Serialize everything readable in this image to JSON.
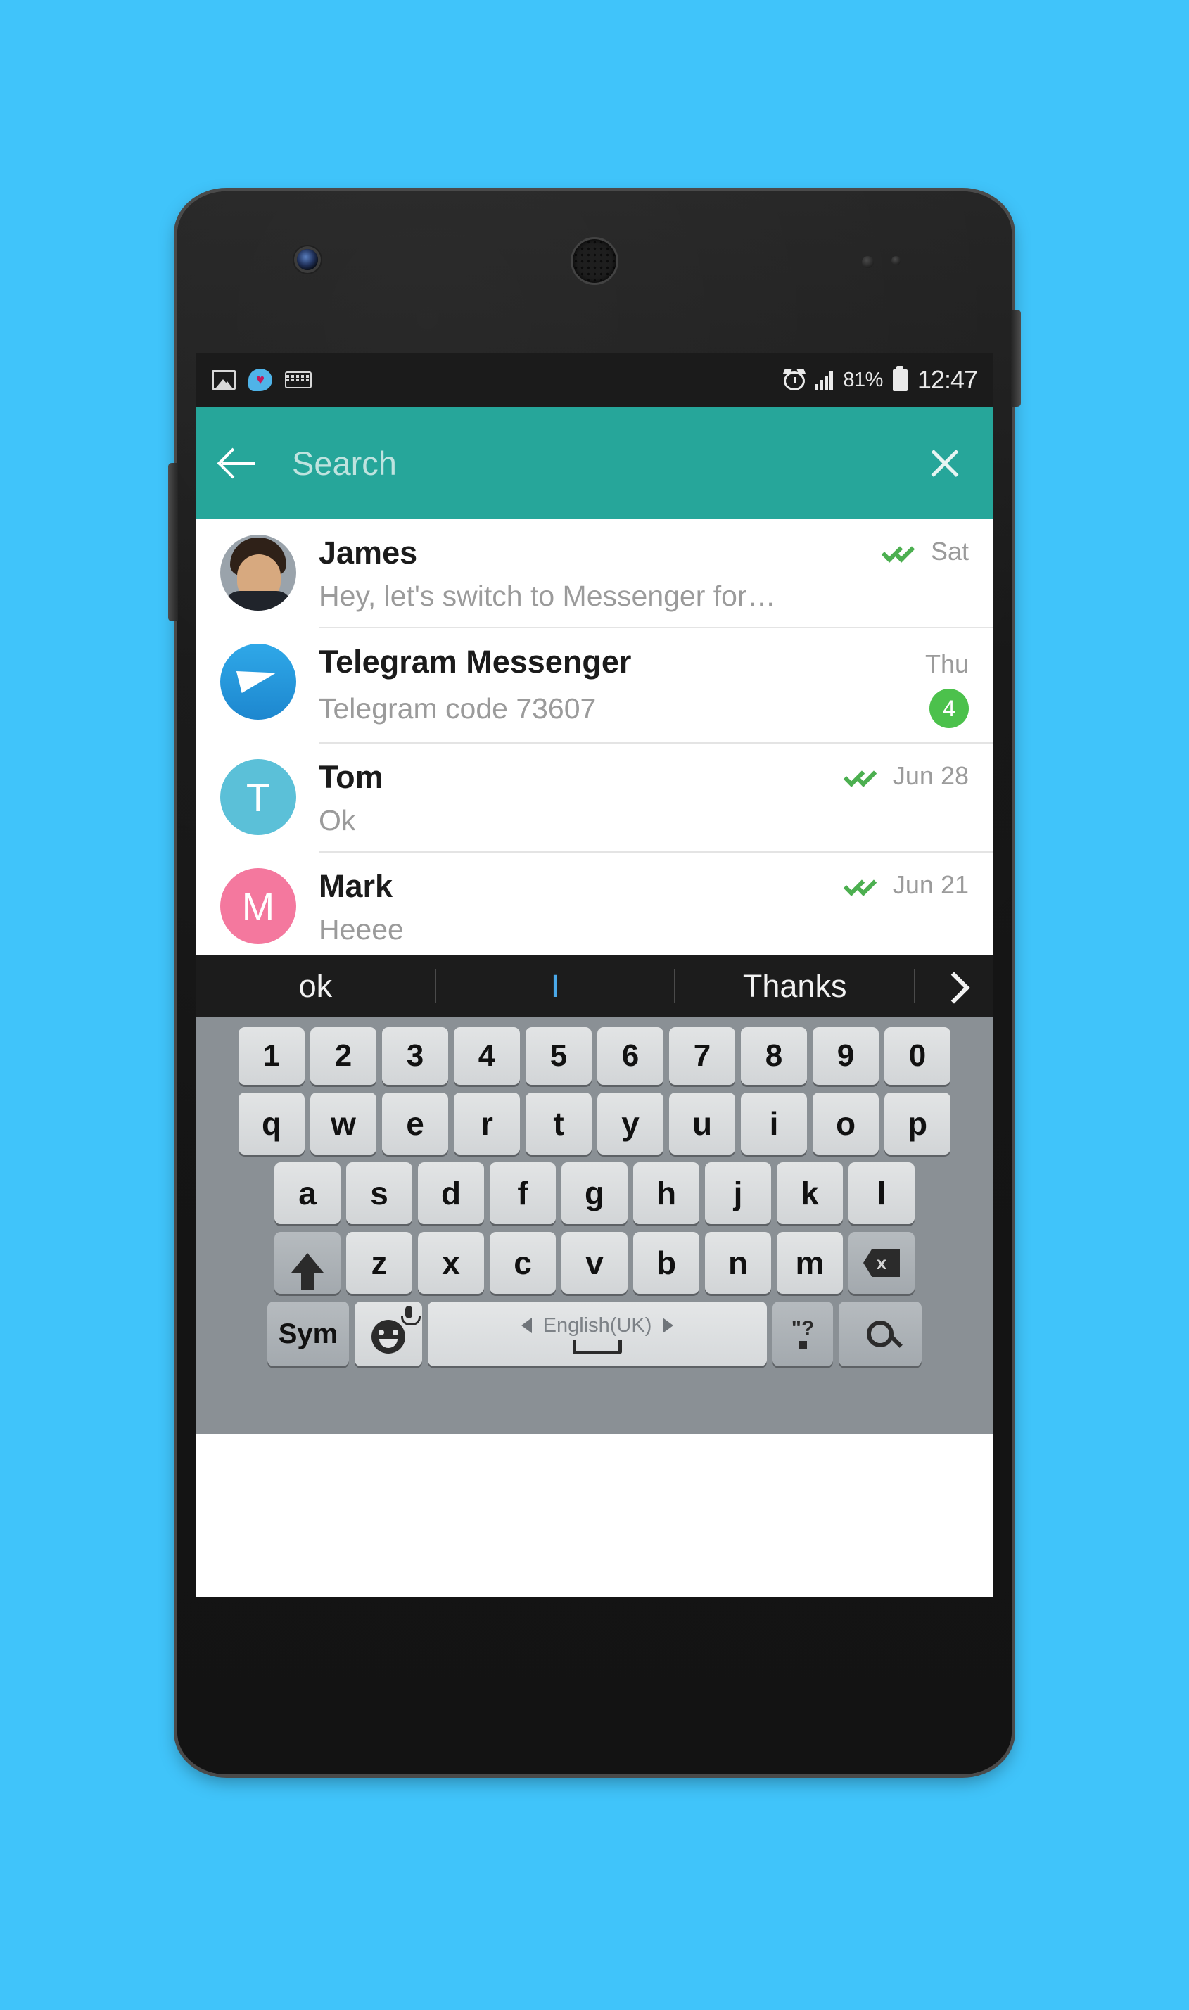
{
  "background_color": "#40c4fa",
  "status_bar": {
    "notification_icons": [
      "image-icon",
      "message-bubble-icon",
      "keyboard-icon"
    ],
    "alarm_icon": "alarm-icon",
    "signal_icon": "signal-bars-icon",
    "battery_percent": "81%",
    "battery_icon": "battery-icon",
    "time": "12:47"
  },
  "search_header": {
    "back_icon": "back-arrow-icon",
    "placeholder": "Search",
    "value": "",
    "clear_icon": "close-icon",
    "accent_color": "#26a69a"
  },
  "chats": [
    {
      "name": "James",
      "preview": "Hey, let's switch to Messenger for…",
      "time": "Sat",
      "ticks": true,
      "badge": "",
      "avatar_type": "photo",
      "avatar_letter": "",
      "avatar_color": "#9aa3ab"
    },
    {
      "name": "Telegram Messenger",
      "preview": "Telegram code 73607",
      "time": "Thu",
      "ticks": false,
      "badge": "4",
      "avatar_type": "telegram",
      "avatar_letter": "",
      "avatar_color": "#2fa8e8"
    },
    {
      "name": "Tom",
      "preview": "Ok",
      "time": "Jun 28",
      "ticks": true,
      "badge": "",
      "avatar_type": "letter",
      "avatar_letter": "T",
      "avatar_color": "#5bc0d8"
    },
    {
      "name": "Mark",
      "preview": "Heeee",
      "time": "Jun 21",
      "ticks": true,
      "badge": "",
      "avatar_type": "letter",
      "avatar_letter": "M",
      "avatar_color": "#f4789e"
    }
  ],
  "badge_color": "#4cc14c",
  "tick_color": "#4caf50",
  "suggestions": {
    "left": "ok",
    "center": "I",
    "right": "Thanks",
    "expand_icon": "chevron-right-icon",
    "center_color": "#4aa8e8"
  },
  "keyboard": {
    "row_numbers": [
      "1",
      "2",
      "3",
      "4",
      "5",
      "6",
      "7",
      "8",
      "9",
      "0"
    ],
    "row_top": [
      "q",
      "w",
      "e",
      "r",
      "t",
      "y",
      "u",
      "i",
      "o",
      "p"
    ],
    "row_home": [
      "a",
      "s",
      "d",
      "f",
      "g",
      "h",
      "j",
      "k",
      "l"
    ],
    "row_bottom": [
      "z",
      "x",
      "c",
      "v",
      "b",
      "n",
      "m"
    ],
    "shift_icon": "shift-arrow-icon",
    "backspace_icon": "backspace-icon",
    "backspace_label": "x",
    "sym_label": "Sym",
    "emoji_icon": "emoji-mic-icon",
    "space_language": "English(UK)",
    "space_prev_icon": "triangle-left-icon",
    "space_next_icon": "triangle-right-icon",
    "space_icon": "spacebar-icon",
    "punct_top": "\"?",
    "punct_bottom": ".",
    "search_icon": "search-magnifier-icon"
  }
}
